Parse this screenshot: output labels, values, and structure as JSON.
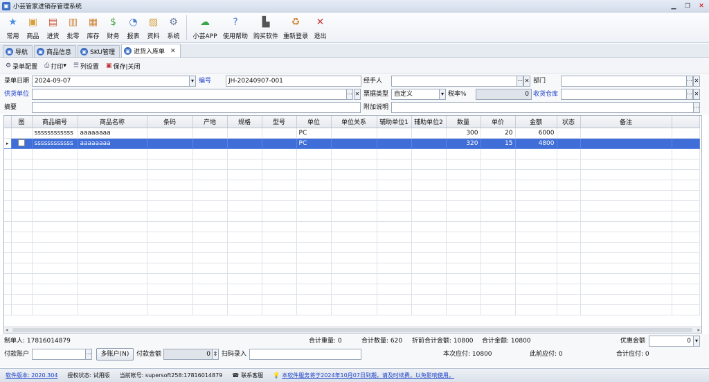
{
  "window": {
    "title": "小芸管家进销存管理系统"
  },
  "toolbar": [
    {
      "label": "常用",
      "icon": "star-icon",
      "color": "#4a8be0"
    },
    {
      "label": "商品",
      "icon": "box-icon",
      "color": "#d9a13b"
    },
    {
      "label": "进货",
      "icon": "import-icon",
      "color": "#d05a3a"
    },
    {
      "label": "批零",
      "icon": "wholesale-icon",
      "color": "#d0863a"
    },
    {
      "label": "库存",
      "icon": "inventory-icon",
      "color": "#d0863a"
    },
    {
      "label": "财务",
      "icon": "finance-icon",
      "color": "#4aa54a"
    },
    {
      "label": "报表",
      "icon": "report-icon",
      "color": "#4a7fd0"
    },
    {
      "label": "资料",
      "icon": "data-icon",
      "color": "#d0a03a"
    },
    {
      "label": "系统",
      "icon": "system-icon",
      "color": "#6a7fa0"
    }
  ],
  "toolbar2": [
    {
      "label": "小芸APP",
      "icon": "app-icon",
      "color": "#3aa64a"
    },
    {
      "label": "使用帮助",
      "icon": "help-icon",
      "color": "#4a7fd0"
    },
    {
      "label": "购买软件",
      "icon": "cart-icon",
      "color": "#555555"
    },
    {
      "label": "重新登录",
      "icon": "relogin-icon",
      "color": "#d0863a"
    },
    {
      "label": "退出",
      "icon": "exit-icon",
      "color": "#d03a3a"
    }
  ],
  "tabs": [
    {
      "label": "导航",
      "active": false,
      "closable": false
    },
    {
      "label": "商品信息",
      "active": false,
      "closable": false
    },
    {
      "label": "SKU管理",
      "active": false,
      "closable": false
    },
    {
      "label": "进货入库单",
      "active": true,
      "closable": true
    }
  ],
  "subtoolbar": {
    "config": "录单配置",
    "print": "打印",
    "columns": "列设置",
    "save_close": "保存|关闭"
  },
  "form": {
    "date_label": "录单日期",
    "date_value": "2024-09-07",
    "number_label": "编号",
    "number_value": "JH-20240907-001",
    "handler_label": "经手人",
    "handler_value": "",
    "dept_label": "部门",
    "dept_value": "",
    "supplier_label": "供货单位",
    "supplier_value": "",
    "invoice_label": "票据类型",
    "invoice_value": "自定义",
    "tax_label": "税率%",
    "tax_value": "0",
    "warehouse_label": "收货仓库",
    "warehouse_value": "",
    "summary_label": "摘要",
    "summary_value": "",
    "note_label": "附加说明",
    "note_value": ""
  },
  "grid": {
    "columns": [
      "图",
      "商品编号",
      "商品名称",
      "条码",
      "产地",
      "规格",
      "型号",
      "单位",
      "单位关系",
      "辅助单位1",
      "辅助单位2",
      "数量",
      "单价",
      "金额",
      "状态",
      "备注"
    ],
    "rows": [
      {
        "code": "ssssssssssss",
        "name": "aaaaaaaa",
        "unit": "PC",
        "qty": "300",
        "price": "20",
        "amount": "6000",
        "selected": false
      },
      {
        "code": "ssssssssssss",
        "name": "aaaaaaaa",
        "unit": "PC",
        "qty": "320",
        "price": "15",
        "amount": "4800",
        "selected": true
      }
    ]
  },
  "footer": {
    "maker": "制单人: 17816014879",
    "total_weight": "合计重量: 0",
    "total_qty": "合计数量: 620",
    "pre_discount": "折前合计金额: 10800",
    "total_amount": "合计金额: 10800",
    "discount_label": "优惠金额",
    "discount_value": "0",
    "pay_account_label": "付款账户",
    "multi_account": "多账户(N)",
    "pay_amount_label": "付款金额",
    "pay_amount_value": "0",
    "scan_label": "扫码录入",
    "this_payable": "本次应付: 10800",
    "prev_payable": "此前应付: 0",
    "total_payable": "合计应付: 0"
  },
  "status": {
    "version": "软件版本: 2020.304",
    "license": "授权状态: 试用版",
    "account": "当前帐号: supersoft258:17816014879",
    "service": "联系客服",
    "notice": "本软件服务将于2024年10月07日到期，请及时续费，以免影响使用。"
  }
}
